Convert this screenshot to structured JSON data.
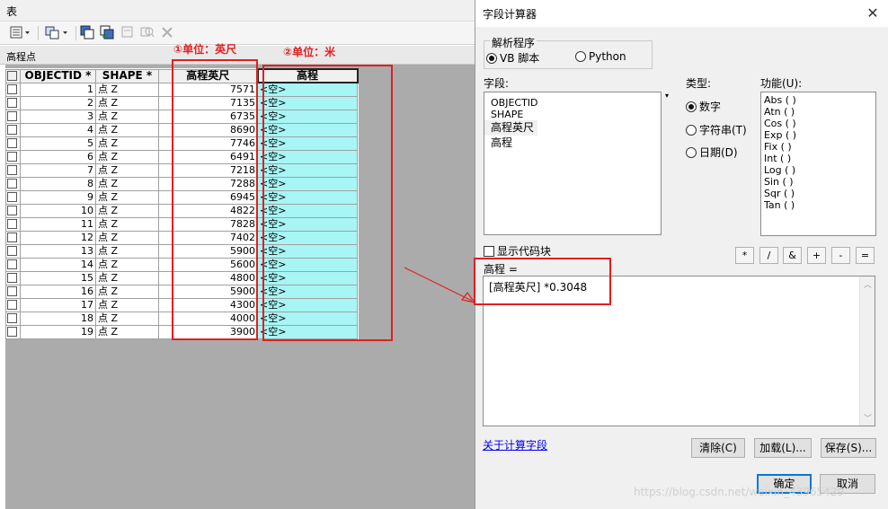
{
  "table_window": {
    "title": "表",
    "layer_name": "高程点",
    "columns": [
      "OBJECTID *",
      "SHAPE *",
      "高程英尺",
      "高程"
    ],
    "rows": [
      {
        "id": "1",
        "shape": "点 Z",
        "ft": "7571",
        "elev": "<空>"
      },
      {
        "id": "2",
        "shape": "点 Z",
        "ft": "7135",
        "elev": "<空>"
      },
      {
        "id": "3",
        "shape": "点 Z",
        "ft": "6735",
        "elev": "<空>"
      },
      {
        "id": "4",
        "shape": "点 Z",
        "ft": "8690",
        "elev": "<空>"
      },
      {
        "id": "5",
        "shape": "点 Z",
        "ft": "7746",
        "elev": "<空>"
      },
      {
        "id": "6",
        "shape": "点 Z",
        "ft": "6491",
        "elev": "<空>"
      },
      {
        "id": "7",
        "shape": "点 Z",
        "ft": "7218",
        "elev": "<空>"
      },
      {
        "id": "8",
        "shape": "点 Z",
        "ft": "7288",
        "elev": "<空>"
      },
      {
        "id": "9",
        "shape": "点 Z",
        "ft": "6945",
        "elev": "<空>"
      },
      {
        "id": "10",
        "shape": "点 Z",
        "ft": "4822",
        "elev": "<空>"
      },
      {
        "id": "11",
        "shape": "点 Z",
        "ft": "7828",
        "elev": "<空>"
      },
      {
        "id": "12",
        "shape": "点 Z",
        "ft": "7402",
        "elev": "<空>"
      },
      {
        "id": "13",
        "shape": "点 Z",
        "ft": "5900",
        "elev": "<空>"
      },
      {
        "id": "14",
        "shape": "点 Z",
        "ft": "5600",
        "elev": "<空>"
      },
      {
        "id": "15",
        "shape": "点 Z",
        "ft": "4800",
        "elev": "<空>"
      },
      {
        "id": "16",
        "shape": "点 Z",
        "ft": "5900",
        "elev": "<空>"
      },
      {
        "id": "17",
        "shape": "点 Z",
        "ft": "4300",
        "elev": "<空>"
      },
      {
        "id": "18",
        "shape": "点 Z",
        "ft": "4000",
        "elev": "<空>"
      },
      {
        "id": "19",
        "shape": "点 Z",
        "ft": "3900",
        "elev": "<空>"
      }
    ]
  },
  "annotations": {
    "unit_ft": "①单位：英尺",
    "unit_m": "②单位：米"
  },
  "dialog": {
    "title": "字段计算器",
    "close_label": "✕",
    "parser_label": "解析程序",
    "parser_vb": "VB 脚本",
    "parser_python": "Python",
    "fields_label": "字段:",
    "fields": [
      "OBJECTID",
      "SHAPE",
      "高程英尺",
      "高程"
    ],
    "type_label": "类型:",
    "type_number": "数字",
    "type_string": "字符串(T)",
    "type_date": "日期(D)",
    "functions_label": "功能(U):",
    "functions": [
      "Abs ( )",
      "Atn ( )",
      "Cos ( )",
      "Exp ( )",
      "Fix ( )",
      "Int ( )",
      "Log ( )",
      "Sin ( )",
      "Sqr ( )",
      "Tan ( )"
    ],
    "show_codeblock": "显示代码块",
    "operators": [
      "*",
      "/",
      "&",
      "+",
      "-",
      "="
    ],
    "expr_label": "高程 =",
    "expression": "[高程英尺] *0.3048",
    "about_link": "关于计算字段",
    "clear_button": "清除(C)",
    "load_button": "加载(L)...",
    "save_button": "保存(S)...",
    "ok_button": "确定",
    "cancel_button": "取消"
  },
  "watermark": "https://blog.csdn.net/weixin_43965429"
}
